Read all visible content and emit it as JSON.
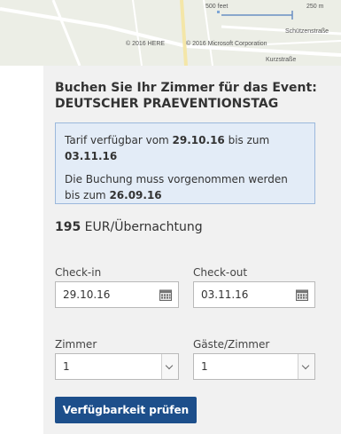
{
  "map": {
    "scale_feet": "500 feet",
    "scale_meters": "250 m",
    "street_1": "Schützenstraße",
    "street_2": "Kurzstraße",
    "attribution_here": "© 2016 HERE",
    "attribution_ms": "© 2016 Microsoft Corporation"
  },
  "booking": {
    "title_line1": "Buchen Sie Ihr Zimmer für das Event:",
    "title_line2": "DEUTSCHER PRAEVENTIONSTAG",
    "info": {
      "rate_prefix": "Tarif verfügbar vom ",
      "rate_from": "29.10.16",
      "rate_mid": " bis zum ",
      "rate_to": "03.11.16",
      "deadline_prefix": "Die Buchung muss vorgenommen werden bis zum ",
      "deadline_date": "26.09.16"
    },
    "price_amount": "195",
    "price_unit": " EUR/Übernachtung",
    "checkin_label": "Check-in",
    "checkin_value": "29.10.16",
    "checkout_label": "Check-out",
    "checkout_value": "03.11.16",
    "rooms_label": "Zimmer",
    "rooms_value": "1",
    "guests_label": "Gäste/Zimmer",
    "guests_value": "1",
    "submit_label": "Verfügbarkeit prüfen"
  },
  "colors": {
    "button": "#1d4f8b",
    "infobox_bg": "#e3ecf7",
    "infobox_border": "#9bb8dc",
    "panel_bg": "#f1f1f1"
  },
  "icons": {
    "checkin": "calendar-icon",
    "checkout": "calendar-icon",
    "rooms": "chevron-down-icon",
    "guests": "chevron-down-icon"
  }
}
